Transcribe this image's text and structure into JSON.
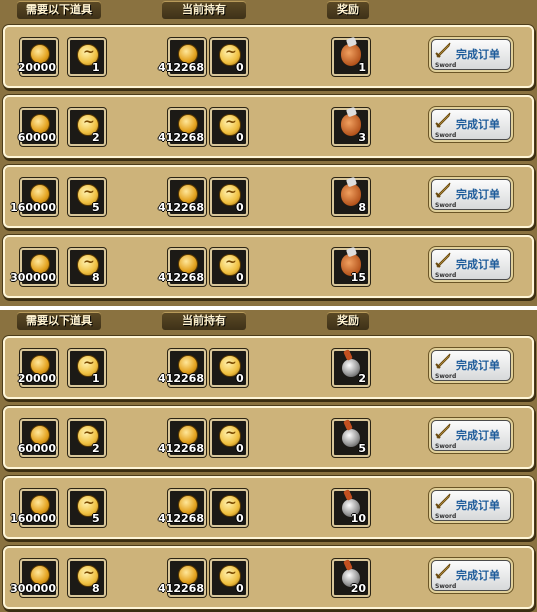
{
  "header": {
    "col_required": "需要以下道具",
    "col_owned": "当前持有",
    "col_reward": "奖励"
  },
  "button": {
    "label": "完成订单",
    "sublabel": "Sword"
  },
  "panels": [
    {
      "rows": [
        {
          "req_coin": "20000",
          "req_token": "1",
          "own_coin": "412268",
          "own_token": "0",
          "reward_icon": "loot-bag-icon",
          "reward": "1"
        },
        {
          "req_coin": "60000",
          "req_token": "2",
          "own_coin": "412268",
          "own_token": "0",
          "reward_icon": "loot-bag-icon",
          "reward": "3"
        },
        {
          "req_coin": "160000",
          "req_token": "5",
          "own_coin": "412268",
          "own_token": "0",
          "reward_icon": "loot-bag-icon",
          "reward": "8"
        },
        {
          "req_coin": "300000",
          "req_token": "8",
          "own_coin": "412268",
          "own_token": "0",
          "reward_icon": "loot-bag-icon",
          "reward": "15"
        }
      ]
    },
    {
      "rows": [
        {
          "req_coin": "20000",
          "req_token": "1",
          "own_coin": "412268",
          "own_token": "0",
          "reward_icon": "bomb-icon",
          "reward": "2"
        },
        {
          "req_coin": "60000",
          "req_token": "2",
          "own_coin": "412268",
          "own_token": "0",
          "reward_icon": "bomb-icon",
          "reward": "5"
        },
        {
          "req_coin": "160000",
          "req_token": "5",
          "own_coin": "412268",
          "own_token": "0",
          "reward_icon": "bomb-icon",
          "reward": "10"
        },
        {
          "req_coin": "300000",
          "req_token": "8",
          "own_coin": "412268",
          "own_token": "0",
          "reward_icon": "bomb-icon",
          "reward": "20"
        }
      ]
    }
  ]
}
